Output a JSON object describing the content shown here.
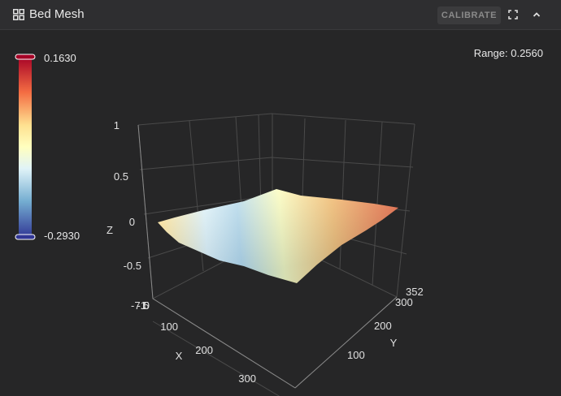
{
  "header": {
    "title": "Bed Mesh",
    "calibrate_label": "CALIBRATE",
    "icons": [
      "grid-icon",
      "fullscreen-icon",
      "chevron-up-icon"
    ]
  },
  "range_label": "Range: 0.2560",
  "colorscale": {
    "max_label": "0.1630",
    "min_label": "-0.2930",
    "colors": [
      "#a50026",
      "#f46d43",
      "#fee090",
      "#ffffbf",
      "#e0f3f8",
      "#74add1",
      "#313695"
    ]
  },
  "axes": {
    "z_title": "Z",
    "x_title": "X",
    "y_title": "Y",
    "z_ticks": [
      "1",
      "0.5",
      "0",
      "-0.5",
      "-1"
    ],
    "x_ticks": [
      "0",
      "100",
      "200",
      "300"
    ],
    "y_ticks": [
      "-7.5",
      "100",
      "200",
      "300",
      "352"
    ]
  },
  "chart_data": {
    "type": "surface",
    "title": "",
    "xlabel": "X",
    "ylabel": "Y",
    "zlabel": "Z",
    "zlim": [
      -1,
      1
    ],
    "color_range": [
      -0.293,
      0.163
    ],
    "grid": true,
    "z_values": [
      [
        -0.02,
        -0.1,
        -0.2,
        -0.29
      ],
      [
        0.0,
        -0.05,
        -0.12,
        -0.18
      ],
      [
        0.05,
        0.02,
        -0.04,
        -0.06
      ],
      [
        0.1,
        0.1,
        0.09,
        0.05
      ],
      [
        0.16,
        0.14,
        0.13,
        0.11
      ]
    ]
  }
}
